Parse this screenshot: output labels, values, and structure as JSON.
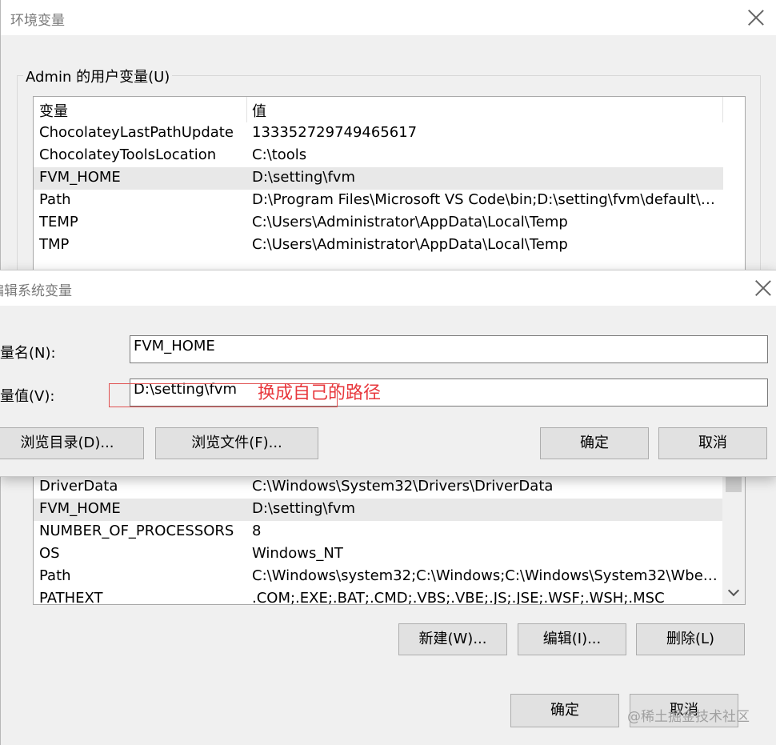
{
  "env_window": {
    "title": "环境变量",
    "user_group_label": "Admin 的用户变量(U)",
    "columns": {
      "name": "变量",
      "value": "值"
    },
    "user_vars": [
      {
        "name": "ChocolateyLastPathUpdate",
        "value": "133352729749465617"
      },
      {
        "name": "ChocolateyToolsLocation",
        "value": "C:\\tools"
      },
      {
        "name": "FVM_HOME",
        "value": "D:\\setting\\fvm"
      },
      {
        "name": "Path",
        "value": "D:\\Program Files\\Microsoft VS Code\\bin;D:\\setting\\fvm\\default\\bi..."
      },
      {
        "name": "TEMP",
        "value": "C:\\Users\\Administrator\\AppData\\Local\\Temp"
      },
      {
        "name": "TMP",
        "value": "C:\\Users\\Administrator\\AppData\\Local\\Temp"
      }
    ],
    "system_vars": [
      {
        "name": "DriverData",
        "value": "C:\\Windows\\System32\\Drivers\\DriverData"
      },
      {
        "name": "FVM_HOME",
        "value": "D:\\setting\\fvm"
      },
      {
        "name": "NUMBER_OF_PROCESSORS",
        "value": "8"
      },
      {
        "name": "OS",
        "value": "Windows_NT"
      },
      {
        "name": "Path",
        "value": "C:\\Windows\\system32;C:\\Windows;C:\\Windows\\System32\\Wbem;..."
      },
      {
        "name": "PATHEXT",
        "value": ".COM;.EXE;.BAT;.CMD;.VBS;.VBE;.JS;.JSE;.WSF;.WSH;.MSC"
      }
    ],
    "buttons": {
      "new": "新建(W)...",
      "edit": "编辑(I)...",
      "delete": "删除(L)",
      "ok": "确定",
      "cancel": "取消"
    }
  },
  "edit_dialog": {
    "title": "编辑系统变量",
    "name_label": "变量名(N):",
    "name_value": "FVM_HOME",
    "value_label": "变量值(V):",
    "value_value": "D:\\setting\\fvm",
    "annotation": "换成自己的路径",
    "buttons": {
      "browse_dir": "浏览目录(D)...",
      "browse_file": "浏览文件(F)...",
      "ok": "确定",
      "cancel": "取消"
    }
  },
  "watermark": "@稀土掘金技术社区",
  "colors": {
    "annotation": "#e8383d",
    "selected_row": "#e8e8e8"
  },
  "icons": {
    "close": "close-icon",
    "scroll_down": "chevron-down-icon"
  }
}
